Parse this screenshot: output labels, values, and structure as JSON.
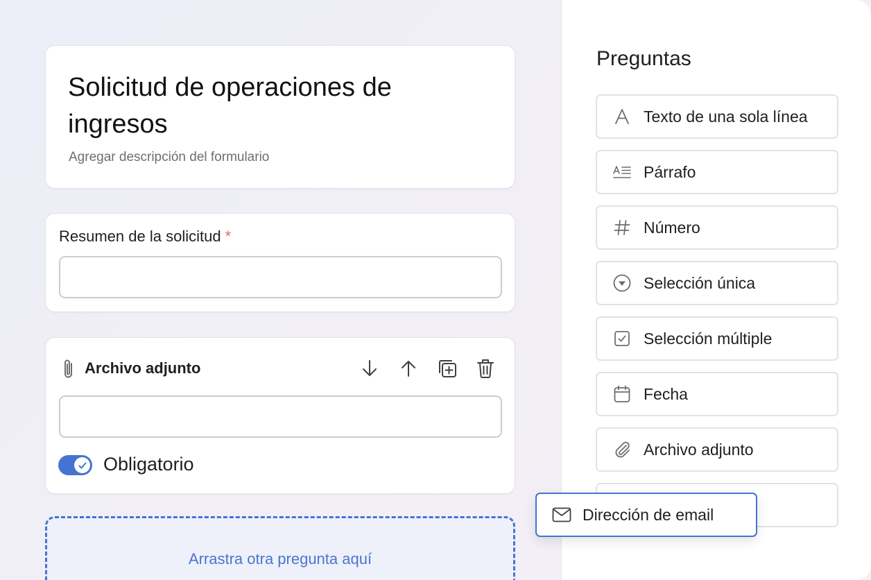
{
  "form": {
    "title": "Solicitud de operaciones de ingresos",
    "description_placeholder": "Agregar descripción del formulario"
  },
  "questions": {
    "summary": {
      "label": "Resumen de la solicitud",
      "required_mark": "*",
      "value": ""
    },
    "attachment": {
      "label": "Archivo adjunto",
      "icon": "paperclip-icon",
      "value": "",
      "required_label": "Obligatorio",
      "required_on": true,
      "tools": [
        "arrow-down-icon",
        "arrow-up-icon",
        "duplicate-icon",
        "trash-icon"
      ]
    }
  },
  "drop_zone": {
    "text": "Arrastra otra pregunta aquí"
  },
  "panel": {
    "title": "Preguntas",
    "items": [
      {
        "label": "Texto de una sola línea",
        "icon": "single-line-text-icon"
      },
      {
        "label": "Párrafo",
        "icon": "paragraph-icon"
      },
      {
        "label": "Número",
        "icon": "hash-icon"
      },
      {
        "label": "Selección única",
        "icon": "single-select-icon"
      },
      {
        "label": "Selección múltiple",
        "icon": "checkbox-icon"
      },
      {
        "label": "Fecha",
        "icon": "calendar-icon"
      },
      {
        "label": "Archivo adjunto",
        "icon": "paperclip-icon"
      }
    ],
    "dragging": {
      "label": "Dirección de email",
      "icon": "mail-icon"
    }
  },
  "colors": {
    "accent": "#4573d2",
    "required_mark": "#e06a6a",
    "drop_zone_text": "#4a76cf"
  }
}
